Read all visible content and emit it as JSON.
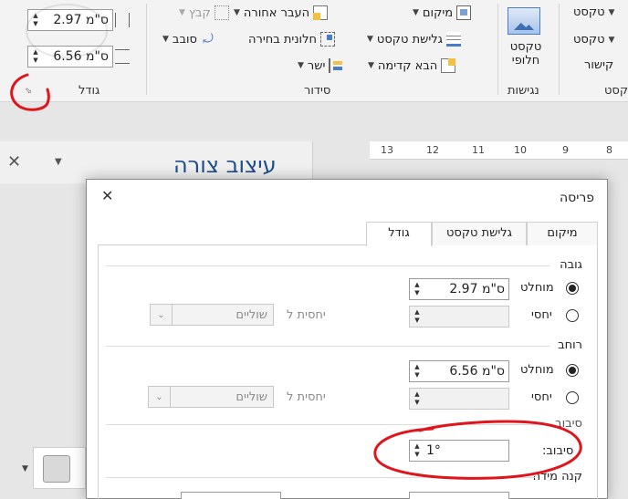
{
  "ribbon": {
    "size_group": {
      "height_value": "2.97 ס\"מ",
      "width_value": "6.56 ס\"מ",
      "group_name": "גודל",
      "crop_label": "קבץ"
    },
    "arrange_group": {
      "bring_forward": "העבר אחורה",
      "bring_forward_front": "הבא קדימה",
      "position": "מיקום",
      "wrap_text": "גלישת טקסט",
      "selection_pane": "חלונית בחירה",
      "rotate": "סובב",
      "align": "ישר",
      "group_name": "סידור"
    },
    "accessibility_group": {
      "alt_text_line1": "טקסט",
      "alt_text_line2": "חלופי",
      "group_name": "נגישות"
    },
    "text_group": {
      "item1": "טקסט",
      "item2": "טקסט",
      "item3": "קישור",
      "group_name": "טקסט"
    }
  },
  "ruler": {
    "labels": [
      "13",
      "12",
      "11",
      "10",
      "9",
      "8"
    ]
  },
  "format_pane": {
    "title": "עיצוב צורה"
  },
  "dialog": {
    "title": "פריסה",
    "tabs": [
      "מיקום",
      "גלישת טקסט",
      "גודל"
    ],
    "height_section": {
      "title": "גובה",
      "absolute_label": "מוחלט",
      "absolute_value": "2.97 ס\"מ",
      "relative_label": "יחסי",
      "relative_to_label": "יחסית ל",
      "relative_to_value": "שוליים"
    },
    "width_section": {
      "title": "רוחב",
      "absolute_label": "מוחלט",
      "absolute_value": "6.56 ס\"מ",
      "relative_label": "יחסי",
      "relative_to_label": "יחסית ל",
      "relative_to_value": "שוליים"
    },
    "rotate_section": {
      "title": "סיבוב",
      "rotation_label": "סיבוב:",
      "rotation_value": "1°"
    },
    "scale_section": {
      "title": "קנה מידה"
    }
  },
  "colors": {
    "annotation": "#e0141b",
    "accent": "#4a7bc8",
    "pane_title": "#1f4e8c"
  }
}
